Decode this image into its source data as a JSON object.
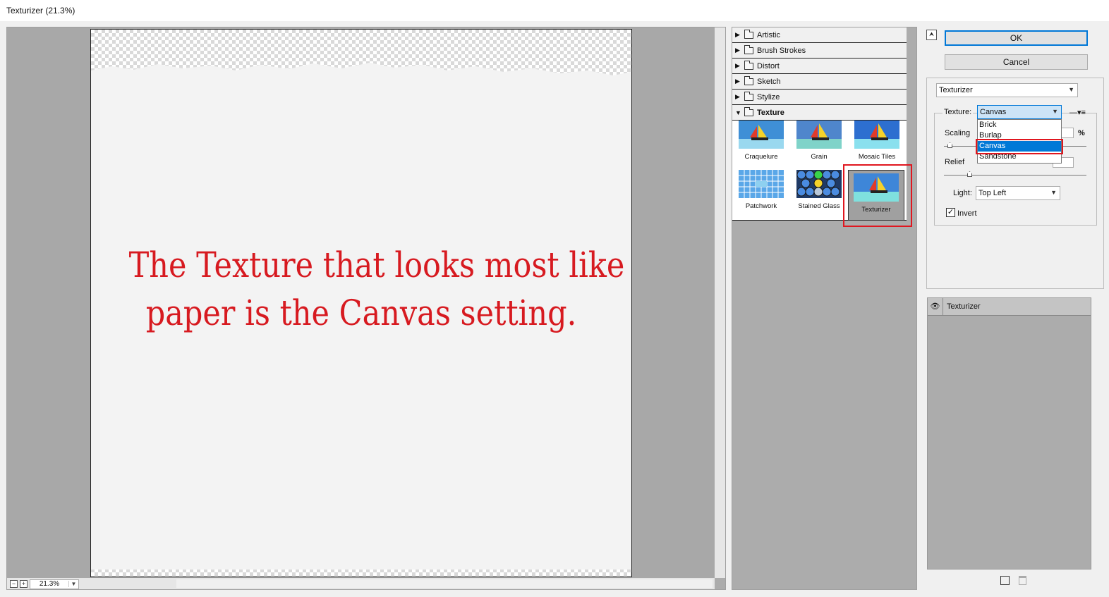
{
  "window": {
    "title": "Texturizer (21.3%)"
  },
  "preview": {
    "zoom": "21.3%",
    "overlay_line1": "The Texture that looks most like",
    "overlay_line2": "paper is the Canvas setting."
  },
  "gallery": {
    "categories": [
      "Artistic",
      "Brush Strokes",
      "Distort",
      "Sketch",
      "Stylize",
      "Texture"
    ],
    "texture_filters": [
      "Craquelure",
      "Grain",
      "Mosaic Tiles",
      "Patchwork",
      "Stained Glass",
      "Texturizer"
    ],
    "selected_filter": "Texturizer"
  },
  "buttons": {
    "ok": "OK",
    "cancel": "Cancel"
  },
  "settings": {
    "filter_select": "Texturizer",
    "texture_label": "Texture:",
    "texture_value": "Canvas",
    "texture_options": [
      "Brick",
      "Burlap",
      "Canvas",
      "Sandstone"
    ],
    "scaling_label": "Scaling",
    "scaling_unit": "%",
    "relief_label": "Relief",
    "light_label": "Light:",
    "light_value": "Top Left",
    "invert_label": "Invert",
    "invert_checked": true
  },
  "layers": {
    "items": [
      "Texturizer"
    ]
  },
  "colors": {
    "annotation_red": "#d71a20",
    "highlight_blue": "#0078d7"
  }
}
